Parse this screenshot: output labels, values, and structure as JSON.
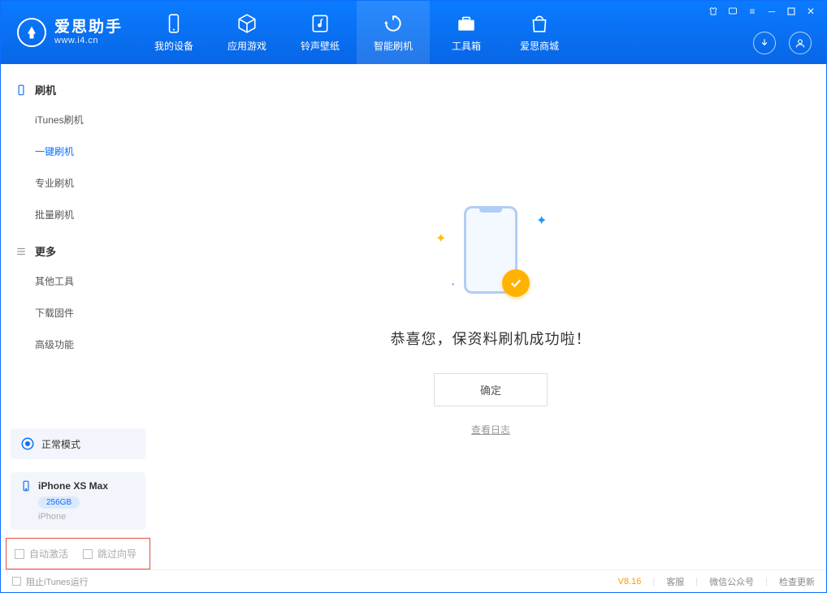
{
  "app": {
    "title": "爱思助手",
    "url": "www.i4.cn"
  },
  "nav": {
    "tabs": [
      {
        "label": "我的设备"
      },
      {
        "label": "应用游戏"
      },
      {
        "label": "铃声壁纸"
      },
      {
        "label": "智能刷机"
      },
      {
        "label": "工具箱"
      },
      {
        "label": "爱思商城"
      }
    ]
  },
  "sidebar": {
    "sections": [
      {
        "title": "刷机",
        "items": [
          {
            "label": "iTunes刷机"
          },
          {
            "label": "一键刷机"
          },
          {
            "label": "专业刷机"
          },
          {
            "label": "批量刷机"
          }
        ]
      },
      {
        "title": "更多",
        "items": [
          {
            "label": "其他工具"
          },
          {
            "label": "下载固件"
          },
          {
            "label": "高级功能"
          }
        ]
      }
    ],
    "mode_label": "正常模式",
    "device": {
      "name": "iPhone XS Max",
      "storage": "256GB",
      "type": "iPhone"
    },
    "checks": {
      "auto_activate": "自动激活",
      "skip_wizard": "跳过向导"
    }
  },
  "main": {
    "success_title": "恭喜您，保资料刷机成功啦！",
    "ok_button": "确定",
    "view_log": "查看日志"
  },
  "footer": {
    "block_itunes": "阻止iTunes运行",
    "version": "V8.16",
    "links": {
      "support": "客服",
      "wechat": "微信公众号",
      "update": "检查更新"
    }
  }
}
